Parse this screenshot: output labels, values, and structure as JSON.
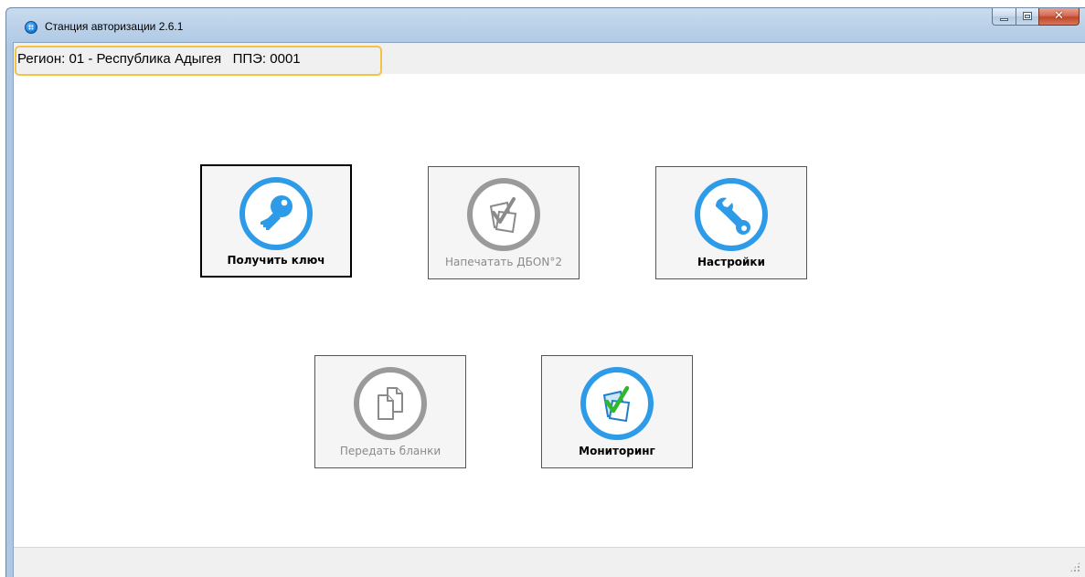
{
  "window": {
    "title": "Станция авторизации 2.6.1",
    "controls": {
      "minimize": "minimize-icon",
      "maximize": "maximize-icon",
      "close": "✕"
    }
  },
  "info_bar": {
    "text": "Регион: 01 - Республика Адыгея   ППЭ: 0001",
    "highlight_color": "#f5c343"
  },
  "tiles": [
    {
      "label": "Получить ключ",
      "icon": "key-icon",
      "state": "selected",
      "icon_color": "#2e9be8"
    },
    {
      "label": "Напечатать ДБОN°2",
      "icon": "print-check-icon",
      "state": "disabled",
      "icon_color": "#9a9a9a"
    },
    {
      "label": "Настройки",
      "icon": "wrench-icon",
      "state": "enabled",
      "icon_color": "#2e9be8"
    },
    {
      "label": "Передать бланки",
      "icon": "documents-icon",
      "state": "disabled",
      "icon_color": "#9a9a9a"
    },
    {
      "label": "Мониторинг",
      "icon": "monitoring-check-icon",
      "state": "enabled",
      "icon_color": "#2e9be8",
      "check_color": "#2db82d"
    }
  ]
}
